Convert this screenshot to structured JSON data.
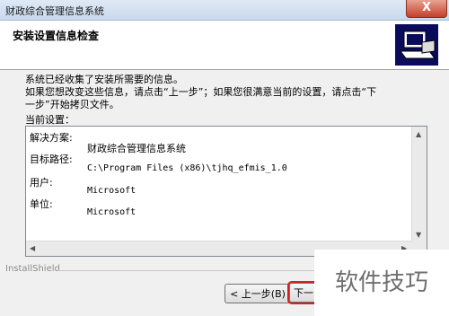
{
  "window": {
    "title": "财政综合管理信息系统",
    "close_glyph": "X"
  },
  "header": {
    "title": "安装设置信息检查",
    "icon": "installer-computer-icon"
  },
  "intro": {
    "line1": "系统已经收集了安装所需要的信息。",
    "line2": "如果您想改变这些信息，请点击“上一步”；如果您很满意当前的设置，请点击“下",
    "line3": "一步”开始拷贝文件。"
  },
  "settings": {
    "label": "当前设置：",
    "solution_label": "解决方案:",
    "solution_value": "财政综合管理信息系统",
    "target_label": "目标路径:",
    "target_value": "C:\\Program Files (x86)\\tjhq_efmis_1.0",
    "user_label": "用户:",
    "user_value": "Microsoft",
    "unit_label": "单位:",
    "unit_value": "Microsoft"
  },
  "footer": {
    "brand": "InstallShield"
  },
  "buttons": {
    "back": "< 上一步(B)",
    "next": "下一"
  },
  "watermark": "软件技巧",
  "colors": {
    "header_icon_bg": "#0b0b5c",
    "highlight": "#d42020"
  }
}
